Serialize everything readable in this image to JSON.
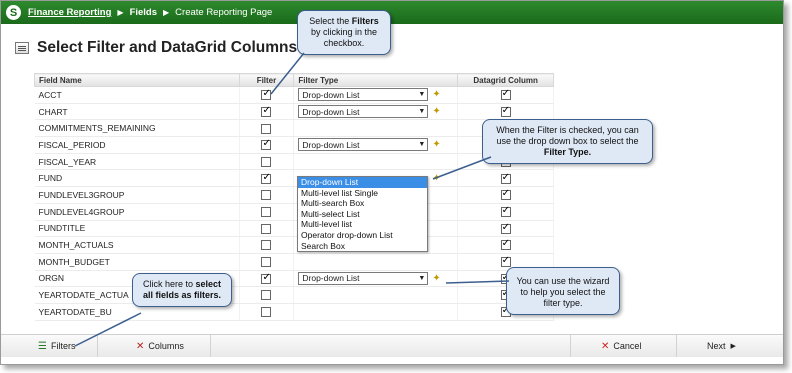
{
  "breadcrumb": {
    "logo": "S",
    "items": [
      "Finance Reporting",
      "Fields",
      "Create Reporting Page"
    ],
    "separator": "▶"
  },
  "page": {
    "title": "Select Filter and DataGrid Columns"
  },
  "table": {
    "headers": {
      "field": "Field Name",
      "filter": "Filter",
      "type": "Filter Type",
      "grid": "Datagrid Column"
    },
    "rows": [
      {
        "name": "ACCT",
        "filter": true,
        "type": "Drop-down List",
        "grid": true
      },
      {
        "name": "CHART",
        "filter": true,
        "type": "Drop-down List",
        "grid": true
      },
      {
        "name": "COMMITMENTS_REMAINING",
        "filter": false,
        "type": "",
        "grid": true
      },
      {
        "name": "FISCAL_PERIOD",
        "filter": true,
        "type": "Drop-down List",
        "grid": true
      },
      {
        "name": "FISCAL_YEAR",
        "filter": false,
        "type": "",
        "grid": true
      },
      {
        "name": "FUND",
        "filter": true,
        "type": "dropdown-open",
        "grid": true
      },
      {
        "name": "FUNDLEVEL3GROUP",
        "filter": false,
        "type": "",
        "grid": true
      },
      {
        "name": "FUNDLEVEL4GROUP",
        "filter": false,
        "type": "",
        "grid": true
      },
      {
        "name": "FUNDTITLE",
        "filter": false,
        "type": "",
        "grid": true
      },
      {
        "name": "MONTH_ACTUALS",
        "filter": false,
        "type": "",
        "grid": true
      },
      {
        "name": "MONTH_BUDGET",
        "filter": false,
        "type": "",
        "grid": true
      },
      {
        "name": "ORGN",
        "filter": true,
        "type": "Drop-down List",
        "grid": true
      },
      {
        "name": "YEARTODATE_ACTUA",
        "filter": false,
        "type": "",
        "grid": true
      },
      {
        "name": "YEARTODATE_BU",
        "filter": false,
        "type": "",
        "grid": true
      }
    ]
  },
  "dropdown_options": [
    "Drop-down List",
    "Multi-level list Single",
    "Multi-search Box",
    "Multi-select List",
    "Multi-level list",
    "Operator drop-down List",
    "Search Box"
  ],
  "callouts": {
    "filters": {
      "pre": "Select the ",
      "bold": "Filters",
      "post": " by clicking in the checkbox."
    },
    "filter_type": {
      "pre": "When the Filter is checked, you can use the drop down box to select the ",
      "bold": "Filter Type."
    },
    "select_all": {
      "pre": "Click here to ",
      "bold": "select all fields as filters."
    },
    "wizard": {
      "text": "You can use the wizard to help you select the filter type."
    }
  },
  "toolbar": {
    "filters": "Filters",
    "columns": "Columns",
    "cancel": "Cancel",
    "next": "Next"
  },
  "colors": {
    "topbar": "#1a6a1a",
    "callout_bg": "#dfe9f6",
    "callout_border": "#3c5f8f",
    "highlight": "#3a8ee6"
  }
}
